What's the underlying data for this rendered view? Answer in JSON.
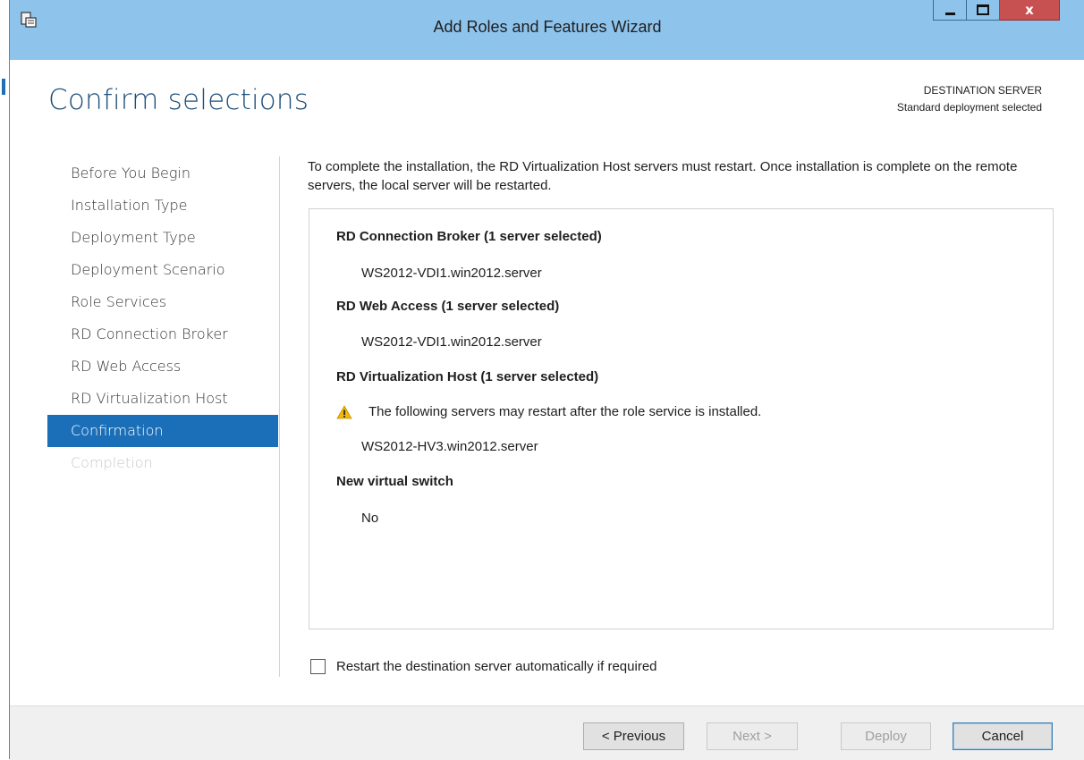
{
  "window": {
    "title": "Add Roles and Features Wizard",
    "close_glyph": "x"
  },
  "page": {
    "heading": "Confirm selections",
    "destination_label": "DESTINATION SERVER",
    "destination_value": "Standard deployment selected"
  },
  "nav": {
    "items": [
      {
        "label": "Before You Begin"
      },
      {
        "label": "Installation Type"
      },
      {
        "label": "Deployment Type"
      },
      {
        "label": "Deployment Scenario"
      },
      {
        "label": "Role Services"
      },
      {
        "label": "RD Connection Broker"
      },
      {
        "label": "RD Web Access"
      },
      {
        "label": "RD Virtualization Host"
      },
      {
        "label": "Confirmation"
      },
      {
        "label": "Completion"
      }
    ]
  },
  "content": {
    "intro": "To complete the installation, the RD Virtualization Host servers must restart. Once installation is complete on the remote servers, the local server will be restarted.",
    "sections": [
      {
        "heading": "RD Connection Broker  (1 server selected)",
        "value": "WS2012-VDI1.win2012.server"
      },
      {
        "heading": "RD Web Access  (1 server selected)",
        "value": "WS2012-VDI1.win2012.server"
      },
      {
        "heading": "RD Virtualization Host  (1 server selected)",
        "warning": "The following servers may restart after the role service is installed.",
        "value": "WS2012-HV3.win2012.server"
      },
      {
        "heading": "New virtual switch",
        "value": "No"
      }
    ],
    "restart_checkbox_label": "Restart the destination server automatically if required",
    "restart_checkbox_checked": false
  },
  "buttons": {
    "previous": "< Previous",
    "next": "Next >",
    "deploy": "Deploy",
    "cancel": "Cancel"
  },
  "colors": {
    "titlebar": "#8ec3ec",
    "nav_active": "#1a6fb8",
    "heading": "#1e4e79",
    "close_button": "#c75050",
    "warning": "#f5b800"
  }
}
